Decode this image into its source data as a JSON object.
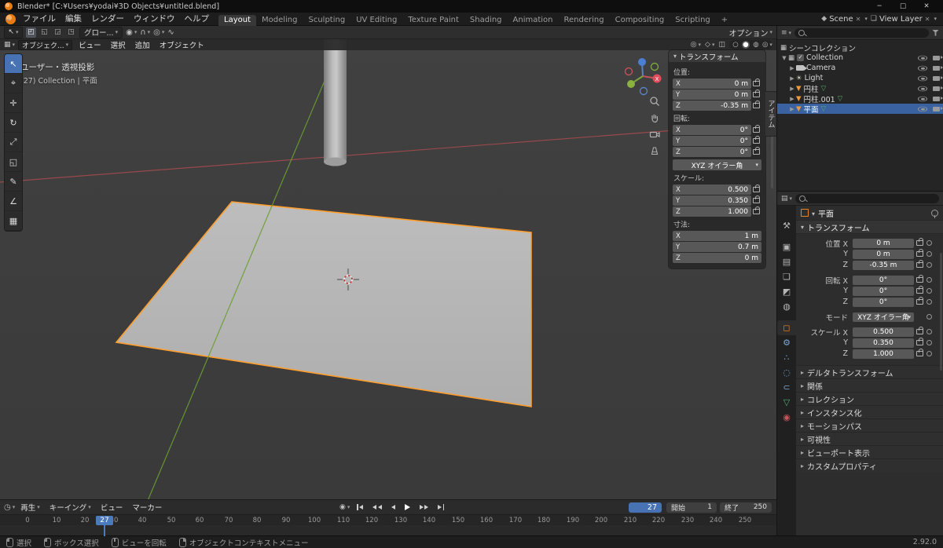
{
  "window": {
    "title": "Blender* [C:¥Users¥yodai¥3D Objects¥untitled.blend]",
    "minimize": "─",
    "maximize": "□",
    "close": "✕"
  },
  "topbar": {
    "menus": [
      "ファイル",
      "編集",
      "レンダー",
      "ウィンドウ",
      "ヘルプ"
    ],
    "workspaces": [
      "Layout",
      "Modeling",
      "Sculpting",
      "UV Editing",
      "Texture Paint",
      "Shading",
      "Animation",
      "Rendering",
      "Compositing",
      "Scripting"
    ],
    "add_workspace": "+",
    "scene_label": "Scene",
    "view_layer_label": "View Layer"
  },
  "tool_header": {
    "orientation": "グロー...",
    "options": "オプション"
  },
  "viewport": {
    "mode": "オブジェク...",
    "menus": [
      "ビュー",
      "選択",
      "追加",
      "オブジェクト"
    ],
    "overlay_line1": "ユーザー・透視投影",
    "overlay_line2": "(27) Collection | 平面",
    "sidebar_tab": "アイテム",
    "axis_x": "X"
  },
  "toolbar": {
    "tools": [
      {
        "name": "select-box",
        "glyph": "↖"
      },
      {
        "name": "cursor",
        "glyph": "⌖"
      },
      {
        "name": "move",
        "glyph": "✛"
      },
      {
        "name": "rotate",
        "glyph": "↻"
      },
      {
        "name": "scale",
        "glyph": "⤢"
      },
      {
        "name": "transform",
        "glyph": "◱"
      },
      {
        "name": "annotate",
        "glyph": "✎"
      },
      {
        "name": "measure",
        "glyph": "∠"
      },
      {
        "name": "add-cube",
        "glyph": "▦"
      }
    ]
  },
  "npanel": {
    "title": "トランスフォーム",
    "location_label": "位置:",
    "loc": [
      {
        "axis": "X",
        "value": "0 m"
      },
      {
        "axis": "Y",
        "value": "0 m"
      },
      {
        "axis": "Z",
        "value": "-0.35 m"
      }
    ],
    "rotation_label": "回転:",
    "rot": [
      {
        "axis": "X",
        "value": "0°"
      },
      {
        "axis": "Y",
        "value": "0°"
      },
      {
        "axis": "Z",
        "value": "0°"
      }
    ],
    "mode_value": "XYZ オイラー角",
    "scale_label": "スケール:",
    "scale": [
      {
        "axis": "X",
        "value": "0.500"
      },
      {
        "axis": "Y",
        "value": "0.350"
      },
      {
        "axis": "Z",
        "value": "1.000"
      }
    ],
    "dimensions_label": "寸法:",
    "dim": [
      {
        "axis": "X",
        "value": "1 m"
      },
      {
        "axis": "Y",
        "value": "0.7 m"
      },
      {
        "axis": "Z",
        "value": "0 m"
      }
    ]
  },
  "outliner": {
    "icons": {
      "scene_collection": "▦",
      "collection": "▦",
      "light": "☀",
      "mesh": "▼",
      "mesh_data": "▽"
    },
    "rows": [
      {
        "label": "シーンコレクション"
      },
      {
        "label": "Collection"
      },
      {
        "label": "Camera"
      },
      {
        "label": "Light"
      },
      {
        "label": "円柱"
      },
      {
        "label": "円柱.001"
      },
      {
        "label": "平面"
      }
    ]
  },
  "properties": {
    "breadcrumb": "平面",
    "transform_title": "トランスフォーム",
    "tabs": [
      {
        "name": "tool",
        "glyph": "⚒"
      },
      {
        "name": "render",
        "glyph": "▣"
      },
      {
        "name": "output",
        "glyph": "▤"
      },
      {
        "name": "view-layer",
        "glyph": "❏"
      },
      {
        "name": "scene",
        "glyph": "◩"
      },
      {
        "name": "world",
        "glyph": "◍"
      },
      {
        "name": "object",
        "glyph": "◻"
      },
      {
        "name": "modifiers",
        "glyph": "⚙"
      },
      {
        "name": "particles",
        "glyph": "∴"
      },
      {
        "name": "physics",
        "glyph": "◌"
      },
      {
        "name": "constraints",
        "glyph": "⊂"
      },
      {
        "name": "object-data",
        "glyph": "▽"
      },
      {
        "name": "material",
        "glyph": "◉"
      }
    ],
    "rows": [
      {
        "label": "位置 X",
        "value": "0 m"
      },
      {
        "label": "Y",
        "value": "0 m"
      },
      {
        "label": "Z",
        "value": "-0.35 m"
      },
      {
        "label": "回転 X",
        "value": "0°"
      },
      {
        "label": "Y",
        "value": "0°"
      },
      {
        "label": "Z",
        "value": "0°"
      },
      {
        "label": "スケール X",
        "value": "0.500"
      },
      {
        "label": "Y",
        "value": "0.350"
      },
      {
        "label": "Z",
        "value": "1.000"
      }
    ],
    "mode_label": "モード",
    "mode_value": "XYZ オイラー角",
    "sections": [
      "デルタトランスフォーム",
      "関係",
      "コレクション",
      "インスタンス化",
      "モーションパス",
      "可視性",
      "ビューポート表示",
      "カスタムプロパティ"
    ]
  },
  "timeline": {
    "menus": [
      "再生",
      "キーイング",
      "ビュー",
      "マーカー"
    ],
    "current_frame": "27",
    "start_label": "開始",
    "start_value": "1",
    "end_label": "終了",
    "end_value": "250",
    "ruler": [
      "0",
      "10",
      "20",
      "30",
      "40",
      "50",
      "60",
      "70",
      "80",
      "90",
      "100",
      "110",
      "120",
      "130",
      "140",
      "150",
      "160",
      "170",
      "180",
      "190",
      "200",
      "210",
      "220",
      "230",
      "240",
      "250"
    ]
  },
  "statusbar": {
    "items": [
      "選択",
      "ボックス選択",
      "ビューを回転",
      "オブジェクトコンテキストメニュー"
    ],
    "version": "2.92.0"
  }
}
